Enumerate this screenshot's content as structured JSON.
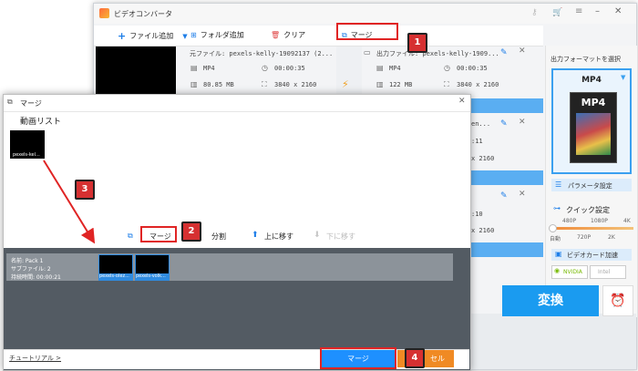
{
  "main_window": {
    "title": "ビデオコンバータ",
    "toolbar": {
      "add_file": "ファイル追加",
      "add_folder": "フォルダ追加",
      "clear": "クリア",
      "merge": "マージ"
    },
    "file_row": {
      "source_label": "元ファイル: pexels-kelly-19092137 (2...",
      "output_label": "出力ファイル: pexels-kelly-1909...",
      "src_format": "MP4",
      "src_duration": "00:00:35",
      "src_size": "80.85 MB",
      "src_resolution": "3840 x 2160",
      "out_format": "MP4",
      "out_duration": "00:00:35",
      "out_size": "122 MB",
      "out_resolution": "3840 x 2160"
    },
    "partial_rows": [
      "en...",
      ":11",
      "x 2160",
      ":10",
      "x 2160",
      ":10",
      "x 2160"
    ],
    "right_panel": {
      "format_heading": "出力フォーマットを選択",
      "format_value": "MP4",
      "format_image_text": "MP4",
      "param_button": "パラメータ設定",
      "quick_setting": "クイック設定",
      "quality_ticks": [
        "480P",
        "1080P",
        "4K"
      ],
      "quality_ticks_bottom": [
        "自動",
        "720P",
        "2K"
      ],
      "gpu_accel": "ビデオカード加速",
      "nvidia": "NVIDIA",
      "intel": "Intel"
    },
    "convert_button": "変換"
  },
  "dialog": {
    "title": "マージ",
    "video_list_label": "動画リスト",
    "clip_name": "pexels-kel...",
    "actions": {
      "merge": "マージ",
      "split": "分割",
      "move_up": "上に移す",
      "move_down": "下に移す"
    },
    "pack": {
      "name": "名前: Pack 1",
      "sub_files": "サブファイル: 2",
      "duration": "持続時間: 00:00:21",
      "clips": [
        "pexels-olez...",
        "pexels-volk..."
      ]
    },
    "tutorial_link": "チュートリアル >",
    "merge_button": "マージ",
    "cancel_partial": "セル"
  },
  "markers": [
    "1",
    "2",
    "3",
    "4"
  ],
  "colors": {
    "accent_blue": "#1e90ff",
    "convert_blue": "#1a9bf0",
    "marker_red": "#d63031",
    "orange": "#f08a24"
  }
}
